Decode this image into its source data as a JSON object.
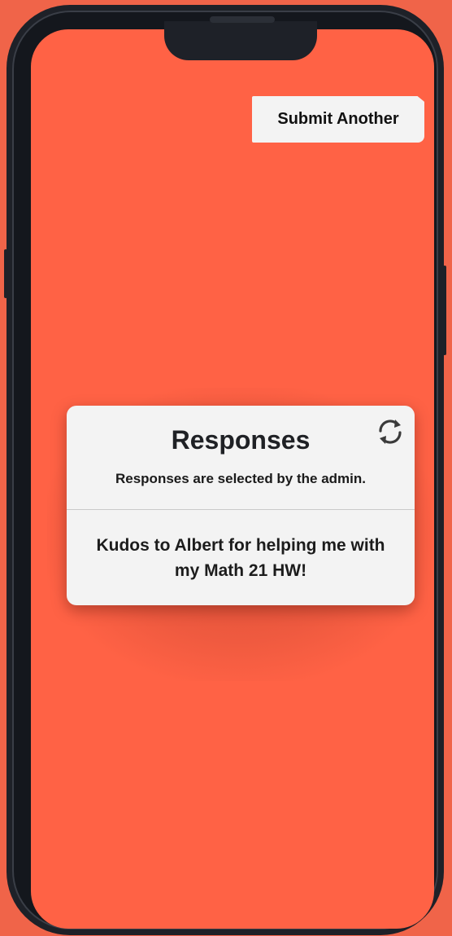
{
  "header": {
    "submit_another_label": "Submit Another"
  },
  "responses_card": {
    "title": "Responses",
    "subtitle": "Responses are selected by the admin.",
    "refresh_icon": "refresh-icon",
    "response_text": "Kudos to Albert for helping me with my Math 21 HW!"
  },
  "colors": {
    "background": "#ff6245",
    "card": "#f3f3f3",
    "phone_frame": "#1e2128"
  }
}
